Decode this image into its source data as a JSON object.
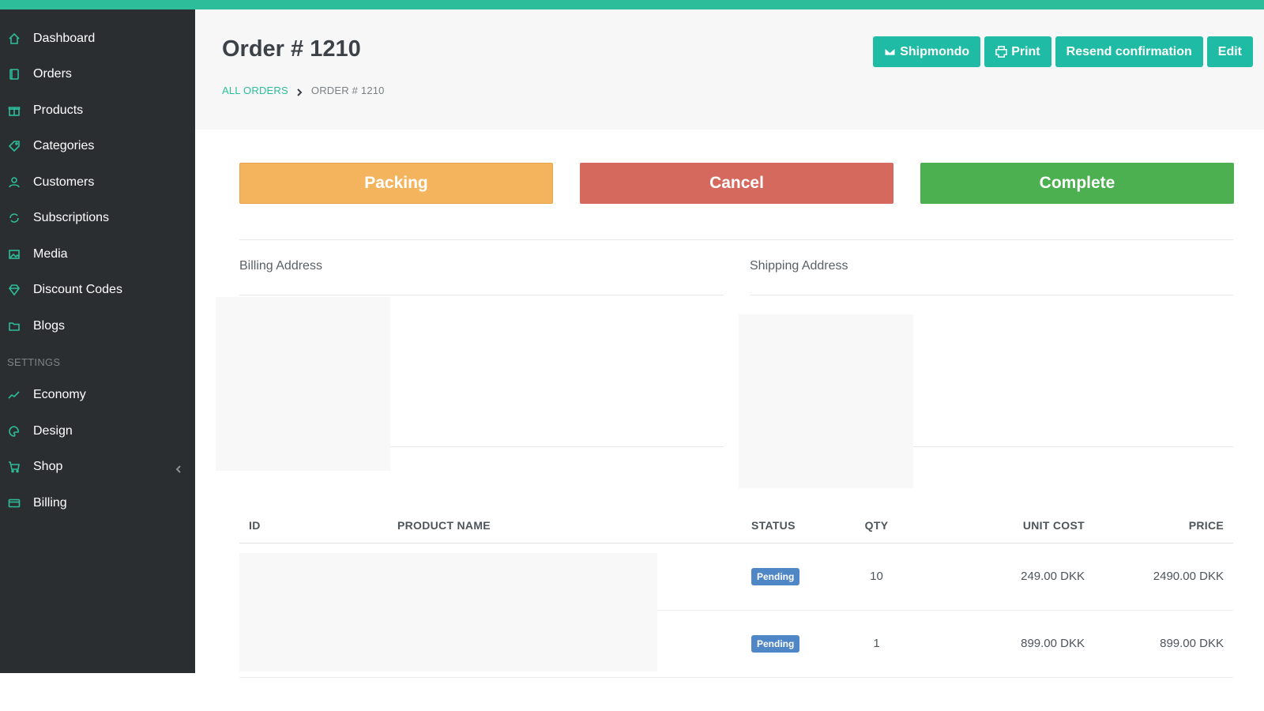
{
  "colors": {
    "accent": "#2dbd9a",
    "sidebar_bg": "#2b2e31",
    "packing": "#f4b45e",
    "cancel": "#d5695e",
    "complete": "#4caf50",
    "badge_pending": "#4f86c6"
  },
  "sidebar": {
    "items": [
      {
        "label": "Dashboard",
        "icon": "home-icon"
      },
      {
        "label": "Orders",
        "icon": "book-icon"
      },
      {
        "label": "Products",
        "icon": "gift-icon"
      },
      {
        "label": "Categories",
        "icon": "tag-icon"
      },
      {
        "label": "Customers",
        "icon": "user-icon"
      },
      {
        "label": "Subscriptions",
        "icon": "refresh-icon"
      },
      {
        "label": "Media",
        "icon": "image-icon"
      },
      {
        "label": "Discount Codes",
        "icon": "diamond-icon"
      },
      {
        "label": "Blogs",
        "icon": "folder-icon"
      }
    ],
    "settings_label": "SETTINGS",
    "settings_items": [
      {
        "label": "Economy",
        "icon": "chart-icon"
      },
      {
        "label": "Design",
        "icon": "palette-icon"
      },
      {
        "label": "Shop",
        "icon": "cart-icon"
      },
      {
        "label": "Billing",
        "icon": "credit-card-icon"
      }
    ]
  },
  "header": {
    "title": "Order # 1210",
    "breadcrumb": {
      "link": "ALL ORDERS",
      "current": "ORDER # 1210"
    },
    "actions": {
      "shipmondo": "Shipmondo",
      "print": "Print",
      "resend": "Resend confirmation",
      "edit": "Edit"
    }
  },
  "status_buttons": {
    "packing": "Packing",
    "cancel": "Cancel",
    "complete": "Complete"
  },
  "addresses": {
    "billing_title": "Billing Address",
    "shipping_title": "Shipping Address"
  },
  "table": {
    "headers": {
      "id": "ID",
      "name": "PRODUCT NAME",
      "status": "STATUS",
      "qty": "QTY",
      "unit": "UNIT COST",
      "price": "PRICE"
    },
    "rows": [
      {
        "status": "Pending",
        "qty": "10",
        "unit": "249.00 DKK",
        "price": "2490.00 DKK"
      },
      {
        "status": "Pending",
        "qty": "1",
        "unit": "899.00 DKK",
        "price": "899.00 DKK"
      }
    ]
  }
}
